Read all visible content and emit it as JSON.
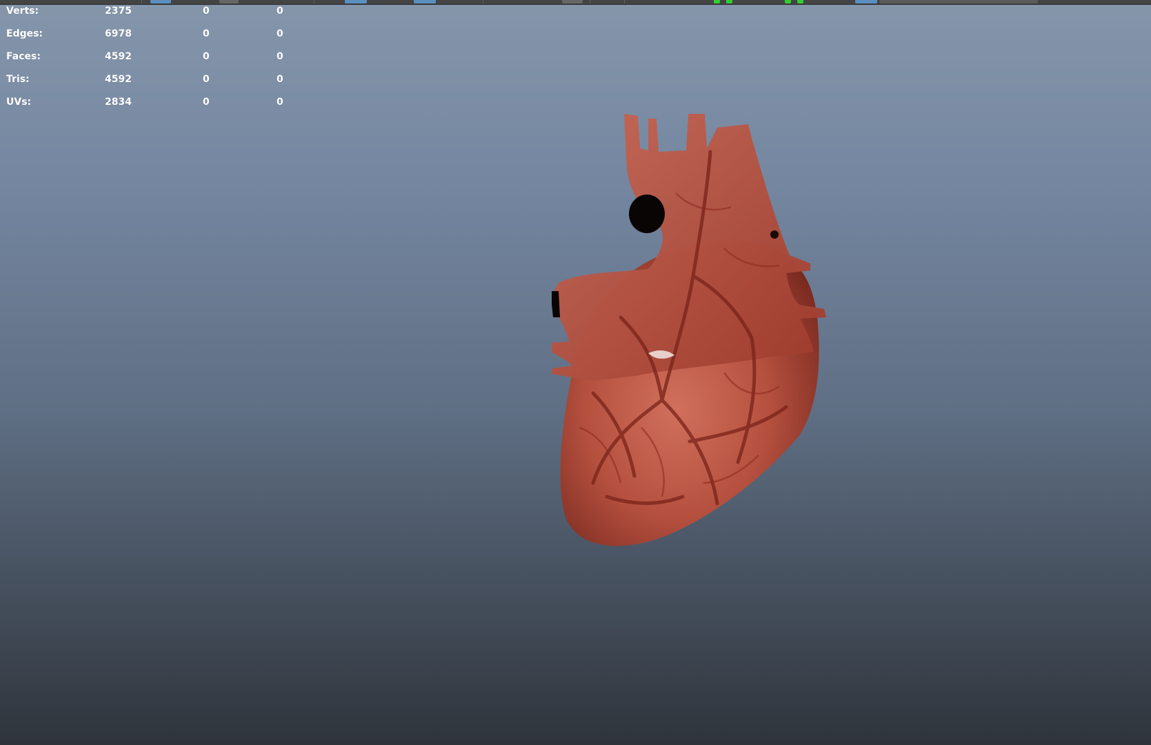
{
  "hud": {
    "rows": [
      {
        "label": "Verts:",
        "value": "2375",
        "c1": "0",
        "c2": "0"
      },
      {
        "label": "Edges:",
        "value": "6978",
        "c1": "0",
        "c2": "0"
      },
      {
        "label": "Faces:",
        "value": "4592",
        "c1": "0",
        "c2": "0"
      },
      {
        "label": "Tris:",
        "value": "4592",
        "c1": "0",
        "c2": "0"
      },
      {
        "label": "UVs:",
        "value": "2834",
        "c1": "0",
        "c2": "0"
      }
    ]
  },
  "colors": {
    "viewport_top": "#8596ab",
    "viewport_bottom": "#2f343b",
    "hud_text": "#ffffff",
    "tissue": "#b5503f",
    "vessel": "#7a2218",
    "indicator_green": "#2fd12f",
    "toolbar_blue": "#5b8fc0"
  },
  "viewport": {
    "model": "heart-model"
  }
}
